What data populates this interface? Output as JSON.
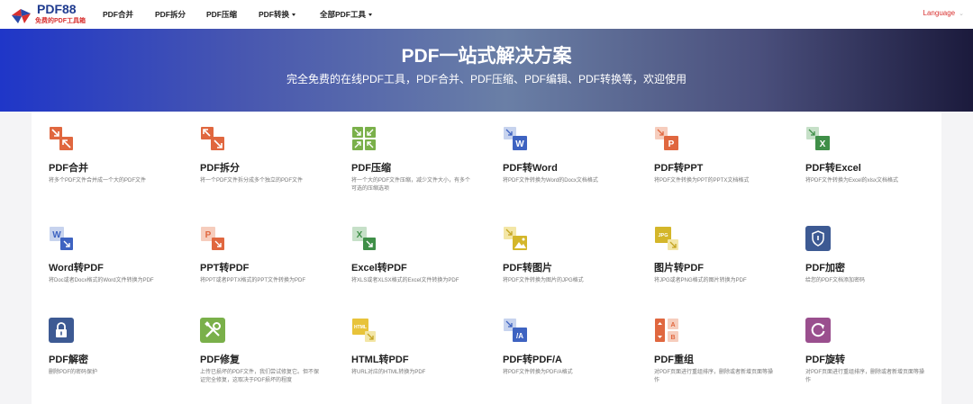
{
  "brand": {
    "name": "PDF88",
    "tagline": "免费的PDF工具箱"
  },
  "nav": {
    "items": [
      {
        "label": "PDF合并",
        "caret": false
      },
      {
        "label": "PDF拆分",
        "caret": false
      },
      {
        "label": "PDF压缩",
        "caret": false
      },
      {
        "label": "PDF转换",
        "caret": true
      },
      {
        "label": "全部PDF工具",
        "caret": true
      }
    ],
    "language": "Language"
  },
  "hero": {
    "title": "PDF一站式解决方案",
    "subtitle": "完全免费的在线PDF工具，PDF合并、PDF压缩、PDF编辑、PDF转换等，欢迎使用"
  },
  "tools": [
    {
      "icon": "merge-icon",
      "title": "PDF合并",
      "desc": "将多个PDF文件合并成一个大的PDF文件",
      "color": "#e0673f"
    },
    {
      "icon": "split-icon",
      "title": "PDF拆分",
      "desc": "将一个PDF文件拆分成多个独立的PDF文件",
      "color": "#e0673f"
    },
    {
      "icon": "compress-icon",
      "title": "PDF压缩",
      "desc": "将一个大的PDF文件压缩，减少文件大小，有多个可选的压缩选项",
      "color": "#7ab04a"
    },
    {
      "icon": "pdf-to-word-icon",
      "title": "PDF转Word",
      "desc": "将PDF文件转换为Word的Docx文档格式",
      "color": "#3e63c1"
    },
    {
      "icon": "pdf-to-ppt-icon",
      "title": "PDF转PPT",
      "desc": "将PDF文件转换为PPT的PPTX文档格式",
      "color": "#e0673f"
    },
    {
      "icon": "pdf-to-excel-icon",
      "title": "PDF转Excel",
      "desc": "将PDF文件转换为Excel的xlsx文档格式",
      "color": "#3f8f48"
    },
    {
      "icon": "word-to-pdf-icon",
      "title": "Word转PDF",
      "desc": "将Doc或者Docx格式的Word文件转换为PDF",
      "color": "#3e63c1"
    },
    {
      "icon": "ppt-to-pdf-icon",
      "title": "PPT转PDF",
      "desc": "将PPT或者PPTX格式的PPT文件转换为PDF",
      "color": "#e0673f"
    },
    {
      "icon": "excel-to-pdf-icon",
      "title": "Excel转PDF",
      "desc": "将XLS或者XLSX格式的Excel文件转换为PDF",
      "color": "#3f8f48"
    },
    {
      "icon": "pdf-to-image-icon",
      "title": "PDF转图片",
      "desc": "将PDF文件转换为图片的JPG格式",
      "color": "#d4b62a"
    },
    {
      "icon": "image-to-pdf-icon",
      "title": "图片转PDF",
      "desc": "将JPG或者PNG格式的图片转换为PDF",
      "color": "#d4b62a"
    },
    {
      "icon": "shield-icon",
      "title": "PDF加密",
      "desc": "给您的PDF文档添加密码",
      "color": "#3d5a93"
    },
    {
      "icon": "lock-icon",
      "title": "PDF解密",
      "desc": "删除PDF的密码保护",
      "color": "#3d5a93"
    },
    {
      "icon": "wrench-icon",
      "title": "PDF修复",
      "desc": "上传已损坏的PDF文件，我们尝试修复它。但不保证完全修复，这取决于PDF损坏的程度",
      "color": "#7ab04a"
    },
    {
      "icon": "html-to-pdf-icon",
      "title": "HTML转PDF",
      "desc": "将URL对应的HTML转换为PDF",
      "color": "#e8c33a"
    },
    {
      "icon": "pdf-to-pdfa-icon",
      "title": "PDF转PDF/A",
      "desc": "将PDF文件转换为PDF/A格式",
      "color": "#3e63c1"
    },
    {
      "icon": "reorder-icon",
      "title": "PDF重组",
      "desc": "对PDF页面进行重组排序，删除或者新增页面等操作",
      "color": "#e0673f"
    },
    {
      "icon": "rotate-icon",
      "title": "PDF旋转",
      "desc": "对PDF页面进行重组排序，删除或者新增页面等操作",
      "color": "#9a4f8e"
    }
  ]
}
